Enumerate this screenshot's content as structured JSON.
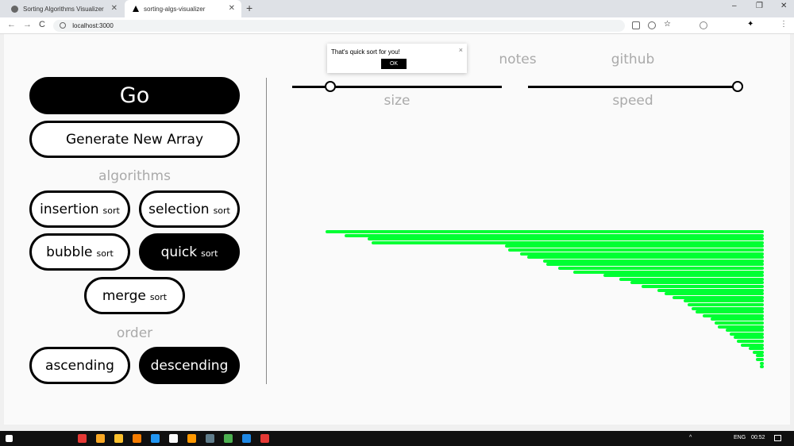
{
  "browser": {
    "tabs": [
      {
        "title": "Sorting Algorithms Visualizer",
        "favicon_color": "#666666"
      },
      {
        "title": "sorting-algs-visualizer",
        "favicon_color": "#000000"
      }
    ],
    "new_tab_label": "+",
    "url": "localhost:3000",
    "window_controls": {
      "minimize": "–",
      "restore": "❐",
      "close": "✕"
    },
    "nav": {
      "back": "←",
      "forward": "→",
      "reload": "C"
    },
    "extension_colors": [
      "#c0392b",
      "#888888",
      "#4527a0",
      "#43a047",
      "#555555",
      "#e91e63"
    ]
  },
  "app": {
    "go_label": "Go",
    "generate_label": "Generate New Array",
    "algorithms_heading": "algorithms",
    "algorithms": [
      {
        "name": "insertion",
        "suffix": "sort",
        "active": false
      },
      {
        "name": "selection",
        "suffix": "sort",
        "active": false
      },
      {
        "name": "bubble",
        "suffix": "sort",
        "active": false
      },
      {
        "name": "quick",
        "suffix": "sort",
        "active": true
      },
      {
        "name": "merge",
        "suffix": "sort",
        "active": false
      }
    ],
    "order_heading": "order",
    "order": [
      {
        "label": "ascending",
        "active": false
      },
      {
        "label": "descending",
        "active": true
      }
    ],
    "nav_links": {
      "notes": "notes",
      "github": "github"
    },
    "size_label": "size",
    "speed_label": "speed",
    "size_value": 0.18,
    "speed_value": 1.0,
    "toast": {
      "message": "That's quick sort for you!",
      "ok_label": "OK",
      "close_label": "×"
    },
    "bar_color": "#00ff33"
  },
  "chart_data": {
    "type": "bar",
    "orientation": "horizontal",
    "values": [
      115,
      110,
      104,
      103,
      68,
      67,
      64,
      62,
      58,
      57,
      54,
      50,
      42,
      38,
      35,
      32,
      28,
      26,
      24,
      21,
      20,
      19,
      18,
      16,
      14,
      13,
      12,
      10,
      9,
      8,
      7,
      6,
      4,
      3,
      2,
      2,
      1,
      1
    ],
    "xlim": [
      0,
      120
    ],
    "title": "",
    "xlabel": "",
    "ylabel": ""
  },
  "taskbar": {
    "language": "ENG",
    "time": "00:52",
    "icon_colors": [
      "#e53935",
      "#f9a825",
      "#fbc02d",
      "#f57c00",
      "#2196f3",
      "#fafafa",
      "#ff9800",
      "#607d8b",
      "#4caf50",
      "#1e88e5",
      "#e53935"
    ]
  }
}
